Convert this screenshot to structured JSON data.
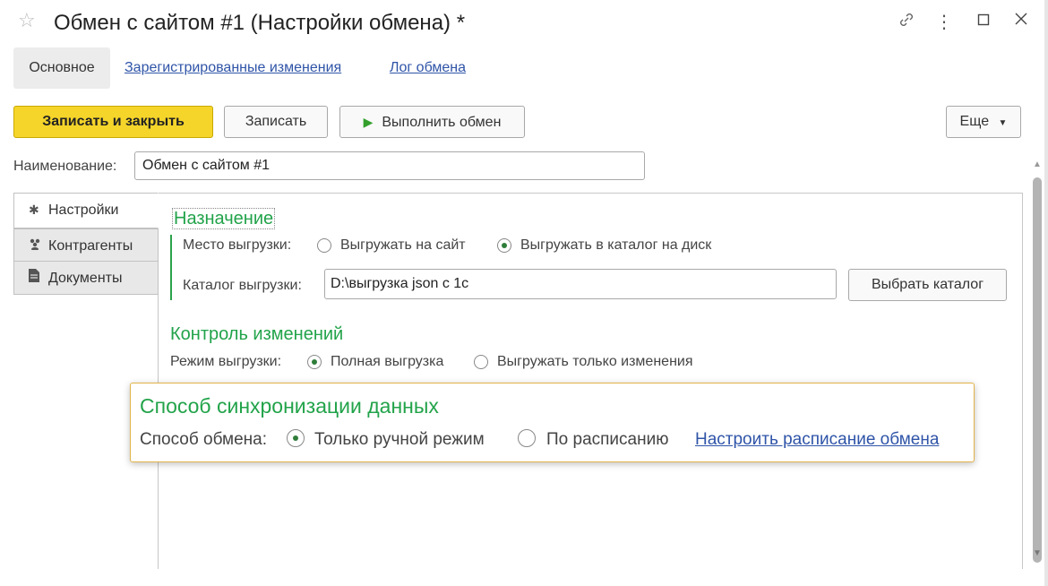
{
  "window": {
    "title": "Обмен с сайтом #1 (Настройки обмена) *",
    "icons": [
      "star-icon",
      "link-icon",
      "more-vertical-icon",
      "maximize-icon",
      "close-icon"
    ]
  },
  "nav": {
    "main": "Основное",
    "registered_changes": "Зарегистрированные изменения",
    "exchange_log": "Лог обмена"
  },
  "toolbar": {
    "save_close": "Записать и закрыть",
    "save": "Записать",
    "run_exchange": "Выполнить обмен",
    "more": "Еще"
  },
  "name": {
    "label": "Наименование:",
    "value": "Обмен с сайтом #1"
  },
  "side_tabs": [
    "Настройки",
    "Контрагенты",
    "Документы"
  ],
  "purpose": {
    "title": "Назначение",
    "upload_place_label": "Место выгрузки:",
    "option_site": "Выгружать на сайт",
    "option_disk": "Выгружать в каталог на диск",
    "selected": "Выгружать в каталог на диск",
    "dir_label": "Каталог выгрузки:",
    "dir_value": "D:\\выгрузка json с 1с",
    "choose_dir": "Выбрать каталог"
  },
  "change_control": {
    "title": "Контроль изменений",
    "mode_label": "Режим выгрузки:",
    "option_full": "Полная выгрузка",
    "option_changes": "Выгружать только изменения",
    "selected": "Полная выгрузка"
  },
  "sync": {
    "title": "Способ синхронизации данных",
    "method_label": "Способ обмена:",
    "option_manual": "Только ручной режим",
    "option_schedule": "По расписанию",
    "selected": "Только ручной режим",
    "schedule_link": "Настроить расписание обмена"
  },
  "colors": {
    "accent_green": "#22a34a",
    "primary_button": "#f5d52a",
    "link": "#2f54a8",
    "highlight_border": "#e2b44a"
  }
}
